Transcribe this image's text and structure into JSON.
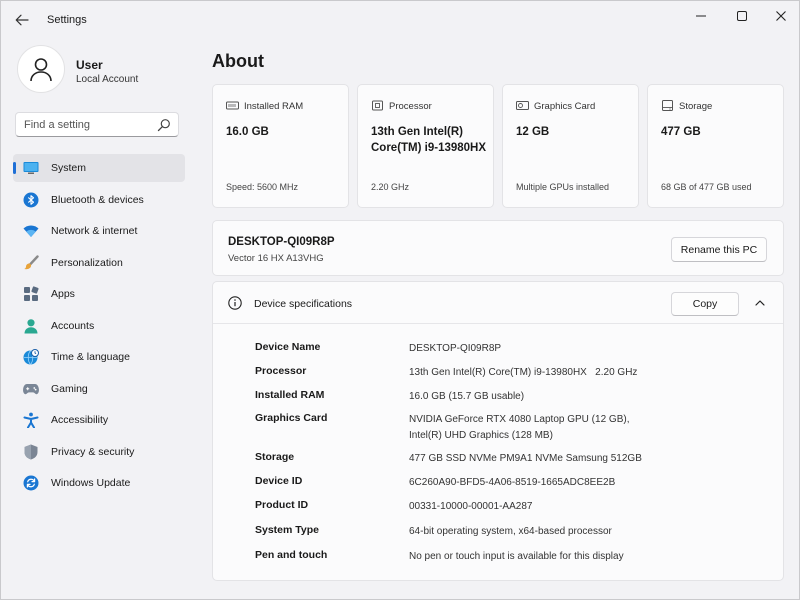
{
  "window": {
    "title": "Settings"
  },
  "user": {
    "name": "User",
    "account": "Local Account"
  },
  "search": {
    "placeholder": "Find a setting"
  },
  "sidebar": {
    "items": [
      {
        "label": "System",
        "icon": "monitor-icon",
        "active": true
      },
      {
        "label": "Bluetooth & devices",
        "icon": "bluetooth-icon"
      },
      {
        "label": "Network & internet",
        "icon": "wifi-icon"
      },
      {
        "label": "Personalization",
        "icon": "brush-icon"
      },
      {
        "label": "Apps",
        "icon": "apps-icon"
      },
      {
        "label": "Accounts",
        "icon": "person-icon"
      },
      {
        "label": "Time & language",
        "icon": "globe-clock-icon"
      },
      {
        "label": "Gaming",
        "icon": "gamepad-icon"
      },
      {
        "label": "Accessibility",
        "icon": "accessibility-icon"
      },
      {
        "label": "Privacy & security",
        "icon": "shield-icon"
      },
      {
        "label": "Windows Update",
        "icon": "update-icon"
      }
    ]
  },
  "main": {
    "title": "About",
    "cards": [
      {
        "label": "Installed RAM",
        "value": "16.0 GB",
        "foot": "Speed: 5600 MHz",
        "icon": "ram-icon"
      },
      {
        "label": "Processor",
        "value": "13th Gen Intel(R) Core(TM) i9-13980HX",
        "foot": "2.20 GHz",
        "icon": "cpu-icon"
      },
      {
        "label": "Graphics Card",
        "value": "12 GB",
        "foot": "Multiple GPUs installed",
        "icon": "gpu-icon"
      },
      {
        "label": "Storage",
        "value": "477 GB",
        "foot": "68 GB of 477 GB used",
        "icon": "storage-icon"
      }
    ],
    "pc": {
      "name": "DESKTOP-QI09R8P",
      "model": "Vector 16 HX A13VHG",
      "rename_label": "Rename this PC"
    },
    "specs": {
      "title": "Device specifications",
      "copy_label": "Copy",
      "rows": [
        {
          "key": "Device Name",
          "value": "DESKTOP-QI09R8P"
        },
        {
          "key": "Processor",
          "value": "13th Gen Intel(R) Core(TM) i9-13980HX   2.20 GHz"
        },
        {
          "key": "Installed RAM",
          "value": "16.0 GB (15.7 GB usable)"
        },
        {
          "key": "Graphics Card",
          "value": "NVIDIA GeForce RTX 4080 Laptop GPU (12 GB),\nIntel(R) UHD Graphics (128 MB)"
        },
        {
          "key": "Storage",
          "value": "477 GB SSD NVMe PM9A1 NVMe Samsung 512GB"
        },
        {
          "key": "Device ID",
          "value": "6C260A90-BFD5-4A06-8519-1665ADC8EE2B"
        },
        {
          "key": "Product ID",
          "value": "00331-10000-00001-AA287"
        },
        {
          "key": "System Type",
          "value": "64-bit operating system, x64-based processor"
        },
        {
          "key": "Pen and touch",
          "value": "No pen or touch input is available for this display"
        }
      ]
    }
  },
  "colors": {
    "accent": "#1e6fd6",
    "background": "#f2f2f5",
    "card": "#fbfbfc"
  }
}
